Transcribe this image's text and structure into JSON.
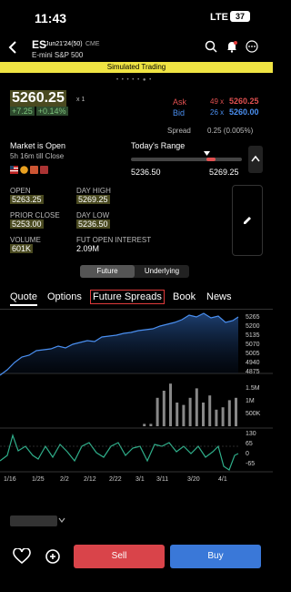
{
  "status": {
    "time": "11:43",
    "network": "LTE",
    "battery": "37"
  },
  "header": {
    "symbol": "ES",
    "contract": "Jun21'24(50)",
    "exchange": "CME",
    "name": "E-mini S&P 500"
  },
  "banner": {
    "text": "Simulated Trading"
  },
  "page_dots": "• • • • • ● •",
  "quote": {
    "price": "5260.25",
    "multiplier": "x 1",
    "change": "+7.25",
    "change_pct": "+0.14%",
    "ask_label": "Ask",
    "ask_size": "49 x",
    "ask_price": "5260.25",
    "bid_label": "Bid",
    "bid_size": "26 x",
    "bid_price": "5260.00",
    "spread_label": "Spread",
    "spread_value": "0.25 (0.005%)"
  },
  "market": {
    "status": "Market is Open",
    "till_close": "5h 16m till Close"
  },
  "range": {
    "label": "Today's Range",
    "low": "5236.50",
    "high": "5269.25",
    "position": 0.72
  },
  "stats": {
    "open_label": "OPEN",
    "open": "5263.25",
    "prior_label": "PRIOR CLOSE",
    "prior": "5253.00",
    "volume_label": "VOLUME",
    "volume": "601K",
    "high_label": "DAY HIGH",
    "high": "5269.25",
    "low_label": "DAY LOW",
    "low": "5236.50",
    "oi_label": "FUT OPEN INTEREST",
    "oi": "2.09M"
  },
  "segment": {
    "future": "Future",
    "underlying": "Underlying"
  },
  "tabs": {
    "quote": "Quote",
    "options": "Options",
    "spreads": "Future Spreads",
    "book": "Book",
    "news": "News"
  },
  "chart_data": {
    "type": "line",
    "price_axis": [
      "5265",
      "5200",
      "5135",
      "5070",
      "5005",
      "4940",
      "4875"
    ],
    "volume_axis": [
      "1.5M",
      "1M",
      "500K"
    ],
    "osc_axis": [
      "130",
      "65",
      "0",
      "-65"
    ],
    "x_ticks": [
      "1/16",
      "1/25",
      "2/2",
      "2/12",
      "2/22",
      "3/1",
      "3/11",
      "3/20",
      "4/1"
    ],
    "colors": {
      "price": "#4a8ff0",
      "volume": "#888888",
      "oscillator": "#2fae8a"
    }
  },
  "actions": {
    "sell": "Sell",
    "buy": "Buy"
  }
}
